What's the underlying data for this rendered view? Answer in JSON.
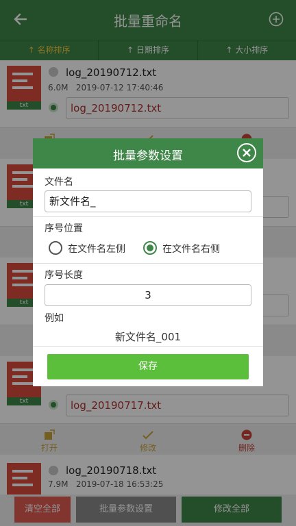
{
  "header": {
    "title": "批量重命名",
    "back_icon": "back-arrow-icon",
    "add_icon": "add-circle-icon"
  },
  "sort": {
    "items": [
      "↑ 名称排序",
      "↑ 日期排序",
      "↑ 大小排序"
    ],
    "active_color": "#f5c842"
  },
  "files": [
    {
      "name": "log_20190712.txt",
      "size": "6.0M",
      "date": "2019-07-12 17:40:46",
      "edit": "log_20190712.txt",
      "ext": "txt"
    },
    {
      "ext": "txt"
    },
    {
      "ext": "txt"
    },
    {
      "edit": "log_20190717.txt",
      "ext": "txt"
    },
    {
      "name": "log_20190718.txt",
      "size": "7.9M",
      "date": "2019-07-18 16:53:25",
      "ext": "txt"
    }
  ],
  "actions": {
    "open": "打开",
    "modify": "修改",
    "delete": "删除"
  },
  "bottom": {
    "clear_all": "清空全部",
    "batch_settings": "批量参数设置",
    "modify_all": "修改全部"
  },
  "dialog": {
    "title": "批量参数设置",
    "filename_label": "文件名",
    "filename_value": "新文件名_",
    "position_label": "序号位置",
    "position_left": "在文件名左侧",
    "position_right": "在文件名右侧",
    "position_selected": "right",
    "length_label": "序号长度",
    "length_value": "3",
    "example_label": "例如",
    "example_value": "新文件名_001",
    "save_label": "保存"
  },
  "colors": {
    "primary": "#3f8748",
    "accent_red": "#d94c3d",
    "save_green": "#5cbf3c",
    "clear_red": "#e05a52",
    "settings_gray": "#8a8a8a",
    "modify_all_green": "#3f8748"
  }
}
